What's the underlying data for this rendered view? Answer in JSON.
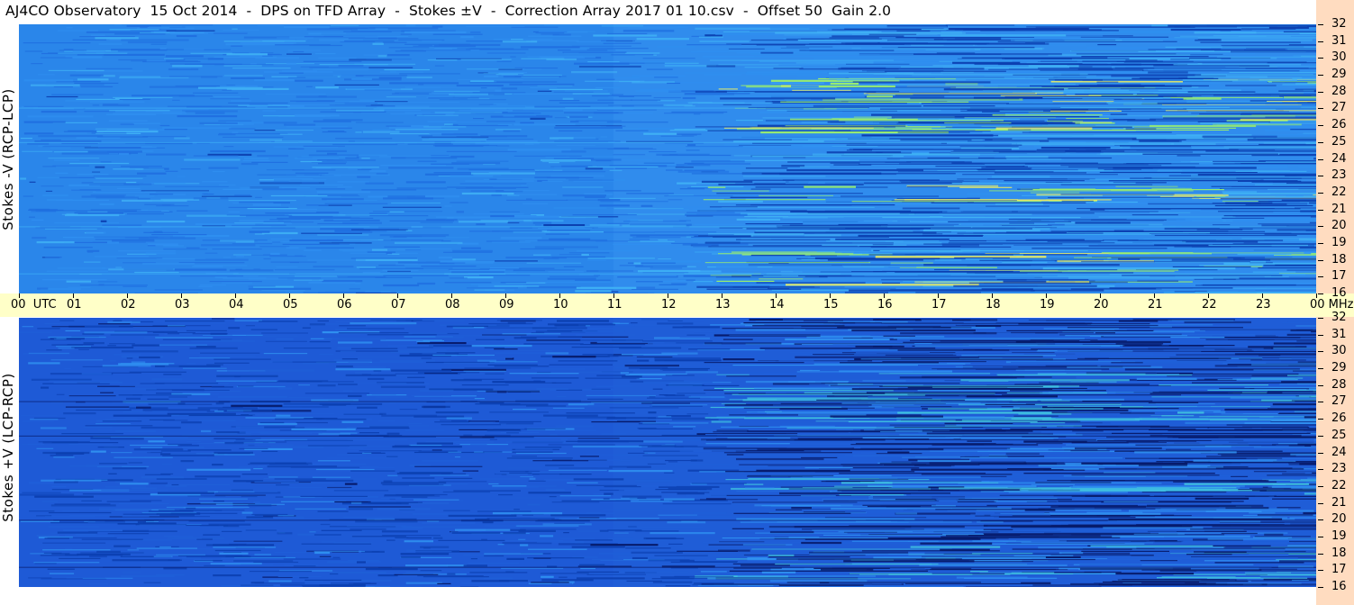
{
  "title": "AJ4CO Observatory  15 Oct 2014  -  DPS on TFD Array  -  Stokes ±V  -  Correction Array 2017 01 10.csv  -  Offset 50  Gain 2.0",
  "chart_data": [
    {
      "type": "heatmap",
      "panel": "top",
      "ylabel": "Stokes -V (RCP-LCP)",
      "xlabel": "UTC",
      "ylabel_unit": "MHz",
      "x_range_hours_utc": [
        0,
        24
      ],
      "y_range_mhz": [
        16,
        32
      ],
      "x_tick_labels": [
        "00",
        "01",
        "02",
        "03",
        "04",
        "05",
        "06",
        "07",
        "08",
        "09",
        "10",
        "11",
        "12",
        "13",
        "14",
        "15",
        "16",
        "17",
        "18",
        "19",
        "20",
        "21",
        "22",
        "23",
        "00"
      ],
      "y_tick_labels": [
        "16",
        "17",
        "18",
        "19",
        "20",
        "21",
        "22",
        "23",
        "24",
        "25",
        "26",
        "27",
        "28",
        "29",
        "30",
        "31",
        "32"
      ],
      "colormap": [
        "#0b3fb0",
        "#1f6fe0",
        "#2f8ff0",
        "#3fb0f5",
        "#9cf06a",
        "#f0f060",
        "#f08040"
      ],
      "base_color": "#2a86ea"
    },
    {
      "type": "heatmap",
      "panel": "bottom",
      "ylabel": "Stokes +V (LCP-RCP)",
      "xlabel": "UTC",
      "ylabel_unit": "MHz",
      "x_range_hours_utc": [
        0,
        24
      ],
      "y_range_mhz": [
        16,
        32
      ],
      "x_tick_labels": [
        "00",
        "01",
        "02",
        "03",
        "04",
        "05",
        "06",
        "07",
        "08",
        "09",
        "10",
        "11",
        "12",
        "13",
        "14",
        "15",
        "16",
        "17",
        "18",
        "19",
        "20",
        "21",
        "22",
        "23",
        "00"
      ],
      "y_tick_labels": [
        "16",
        "17",
        "18",
        "19",
        "20",
        "21",
        "22",
        "23",
        "24",
        "25",
        "26",
        "27",
        "28",
        "29",
        "30",
        "31",
        "32"
      ],
      "colormap": [
        "#061a6a",
        "#0b3fb0",
        "#1f5fd8",
        "#2f8ff0",
        "#3fc0e0",
        "#9cf06a"
      ],
      "base_color": "#1e5ad6"
    }
  ],
  "axis": {
    "utc_label": "UTC",
    "mhz_label": "MHz"
  }
}
